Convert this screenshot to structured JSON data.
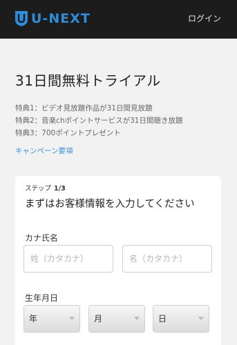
{
  "header": {
    "logo_text": "U-NEXT",
    "login_label": "ログイン",
    "brand_color": "#2f8cd8"
  },
  "main": {
    "title": "31日間無料トライアル",
    "perks": [
      "特典1：ビデオ見放題作品が31日間見放題",
      "特典2：音楽chポイントサービスが31日間聴き放題",
      "特典3：700ポイントプレゼント"
    ],
    "campaign_link": "キャンペーン要項"
  },
  "form": {
    "step_label": "ステップ",
    "step_count": "1/3",
    "heading": "まずはお客様情報を入力してください",
    "kana_label": "カナ氏名",
    "sei_placeholder": "姓（カタカナ）",
    "mei_placeholder": "名（カタカナ）",
    "dob_label": "生年月日",
    "year_value": "年",
    "month_value": "月",
    "day_value": "日"
  }
}
